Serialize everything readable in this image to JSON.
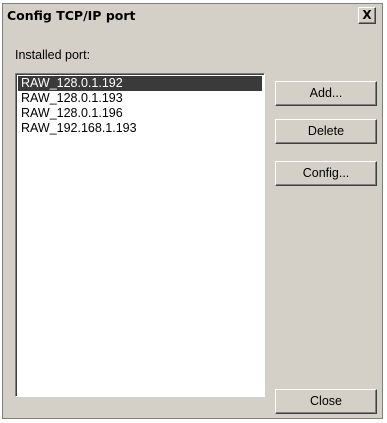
{
  "window": {
    "title": "Config TCP/IP port",
    "close_glyph": "X"
  },
  "installed": {
    "label": "Installed port:",
    "items": [
      {
        "label": "RAW_128.0.1.192",
        "selected": true
      },
      {
        "label": "RAW_128.0.1.193",
        "selected": false
      },
      {
        "label": "RAW_128.0.1.196",
        "selected": false
      },
      {
        "label": "RAW_192.168.1.193",
        "selected": false
      }
    ]
  },
  "buttons": {
    "add": "Add...",
    "delete": "Delete",
    "config": "Config...",
    "close": "Close"
  },
  "colors": {
    "dialog_bg": "#d4d0c8",
    "selection_bg": "#3a3a3a",
    "selection_text": "#ffffff"
  }
}
